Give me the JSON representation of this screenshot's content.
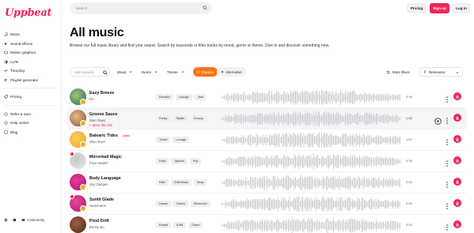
{
  "app": {
    "logo": "Uppbeat",
    "brand_color": "#f0245a"
  },
  "sidebar": {
    "main_items": [
      {
        "label": "Music",
        "icon": "music-note-icon"
      },
      {
        "label": "Sound effects",
        "icon": "sound-effects-icon"
      },
      {
        "label": "Motion graphics",
        "icon": "motion-graphics-icon"
      },
      {
        "label": "LUTs",
        "icon": "luts-icon"
      },
      {
        "label": "Trending",
        "icon": "trending-icon"
      },
      {
        "label": "Playlist generator",
        "icon": "playlist-generator-icon"
      }
    ],
    "secondary_items": [
      {
        "label": "Pricing",
        "icon": "pricing-icon"
      }
    ],
    "tertiary_items": [
      {
        "label": "Refer & earn",
        "icon": "refer-icon"
      },
      {
        "label": "Help center",
        "icon": "help-icon"
      },
      {
        "label": "Blog",
        "icon": "blog-icon"
      }
    ],
    "bottom": {
      "community_label": "Community"
    }
  },
  "header": {
    "search_placeholder": "Search",
    "pricing_label": "Pricing",
    "signup_label": "Sign up",
    "login_label": "Log in"
  },
  "page": {
    "title": "All music",
    "subtitle": "Browse our full music library and find your sound. Search by keywords or filter tracks by mood, genre or theme. Dive in and discover something new."
  },
  "filters": {
    "keyword_placeholder": "Add keyword",
    "mood_label": "Mood",
    "genre_label": "Genre",
    "theme_label": "Theme",
    "popular_label": "Popular",
    "alternative_label": "Alternative",
    "more_filters_label": "More filters",
    "sort_label": "Relevance"
  },
  "tracks": [
    {
      "name": "Easy Breeze",
      "artist": "RA",
      "tags": [
        "Elevator",
        "Lounge",
        "Jazz"
      ],
      "duration": "2:15",
      "art_color": "#2f6b5a",
      "art_color2": "#9ec47a",
      "badge": true,
      "pink": false,
      "new": false,
      "more_like": ""
    },
    {
      "name": "Groove Sauce",
      "artist": "Stan Town",
      "tags": [
        "Funky",
        "Stylish",
        "Groovy"
      ],
      "duration": "1:58",
      "art_color": "#8a5a2b",
      "art_color2": "#e4b98a",
      "badge": true,
      "pink": false,
      "new": false,
      "more_like": "+ More like this",
      "hover": true
    },
    {
      "name": "Balearic Tides",
      "artist": "Stan Town",
      "tags": [
        "Travel",
        "Lounge"
      ],
      "duration": "1:57",
      "art_color": "#f0a030",
      "art_color2": "#f7d05a",
      "badge": true,
      "pink": false,
      "new": true,
      "new_label": "new",
      "more_like": ""
    },
    {
      "name": "Mirrorball Magic",
      "artist": "Floor Model",
      "tags": [
        "Funk",
        "Upbeat",
        "Pop"
      ],
      "duration": "2:33",
      "art_color": "#e8e8ea",
      "art_color2": "#c7c7cc",
      "badge": false,
      "pink": true,
      "new": false,
      "more_like": ""
    },
    {
      "name": "Body Language",
      "artist": "Sky Gangen",
      "tags": [
        "R&B",
        "Chill Beats",
        "Sexy"
      ],
      "duration": "2:22",
      "art_color": "#a0147a",
      "art_color2": "#f03a9b",
      "badge": true,
      "pink": false,
      "new": false,
      "more_like": ""
    },
    {
      "name": "Sunlit Glade",
      "artist": "Hartzmann",
      "tags": [
        "House",
        "Dance",
        "Electronic"
      ],
      "duration": "2:33",
      "art_color": "#b5146e",
      "art_color2": "#e04aa0",
      "badge": true,
      "pink": true,
      "new": false,
      "more_like": ""
    },
    {
      "name": "Pixel Drift",
      "artist": "Bonny Bo",
      "tags": [
        "Kawaii",
        "8-Bit",
        "Game"
      ],
      "duration": "2:13",
      "art_color": "#4a2a1a",
      "art_color2": "#a06040",
      "badge": false,
      "pink": false,
      "new": false,
      "more_like": ""
    }
  ]
}
